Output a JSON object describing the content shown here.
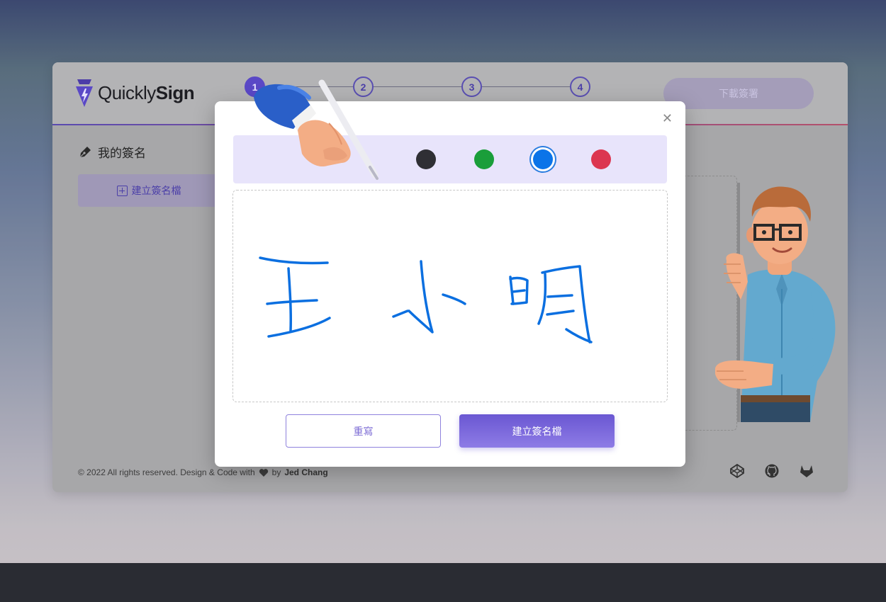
{
  "app": {
    "logo_text_light": "Quickly",
    "logo_text_bold": "Sign"
  },
  "stepper": {
    "steps": [
      "1",
      "2",
      "3",
      "4"
    ],
    "active_step": 1
  },
  "header": {
    "download_label": "下載簽署"
  },
  "left_panel": {
    "title": "我的簽名",
    "title_icon": "pen-nib-icon",
    "create_button_label": "建立簽名檔"
  },
  "footer": {
    "copyright": "© 2022 All rights reserved. Design & Code with",
    "by": "by",
    "author": "Jed Chang",
    "icons": [
      "codepen-icon",
      "github-icon",
      "gitlab-icon"
    ]
  },
  "modal": {
    "close_icon": "close-icon",
    "colors": [
      {
        "name": "black",
        "hex": "#2f2f34",
        "selected": false
      },
      {
        "name": "green",
        "hex": "#1a9e3a",
        "selected": false
      },
      {
        "name": "blue",
        "hex": "#0b74e8",
        "selected": true
      },
      {
        "name": "red",
        "hex": "#dc3650",
        "selected": false
      }
    ],
    "signature_color": "#0b6fe0",
    "reset_label": "重寫",
    "create_label": "建立簽名檔"
  },
  "colors": {
    "accent": "#5a48c6",
    "accent_light": "#8e7ce6"
  }
}
